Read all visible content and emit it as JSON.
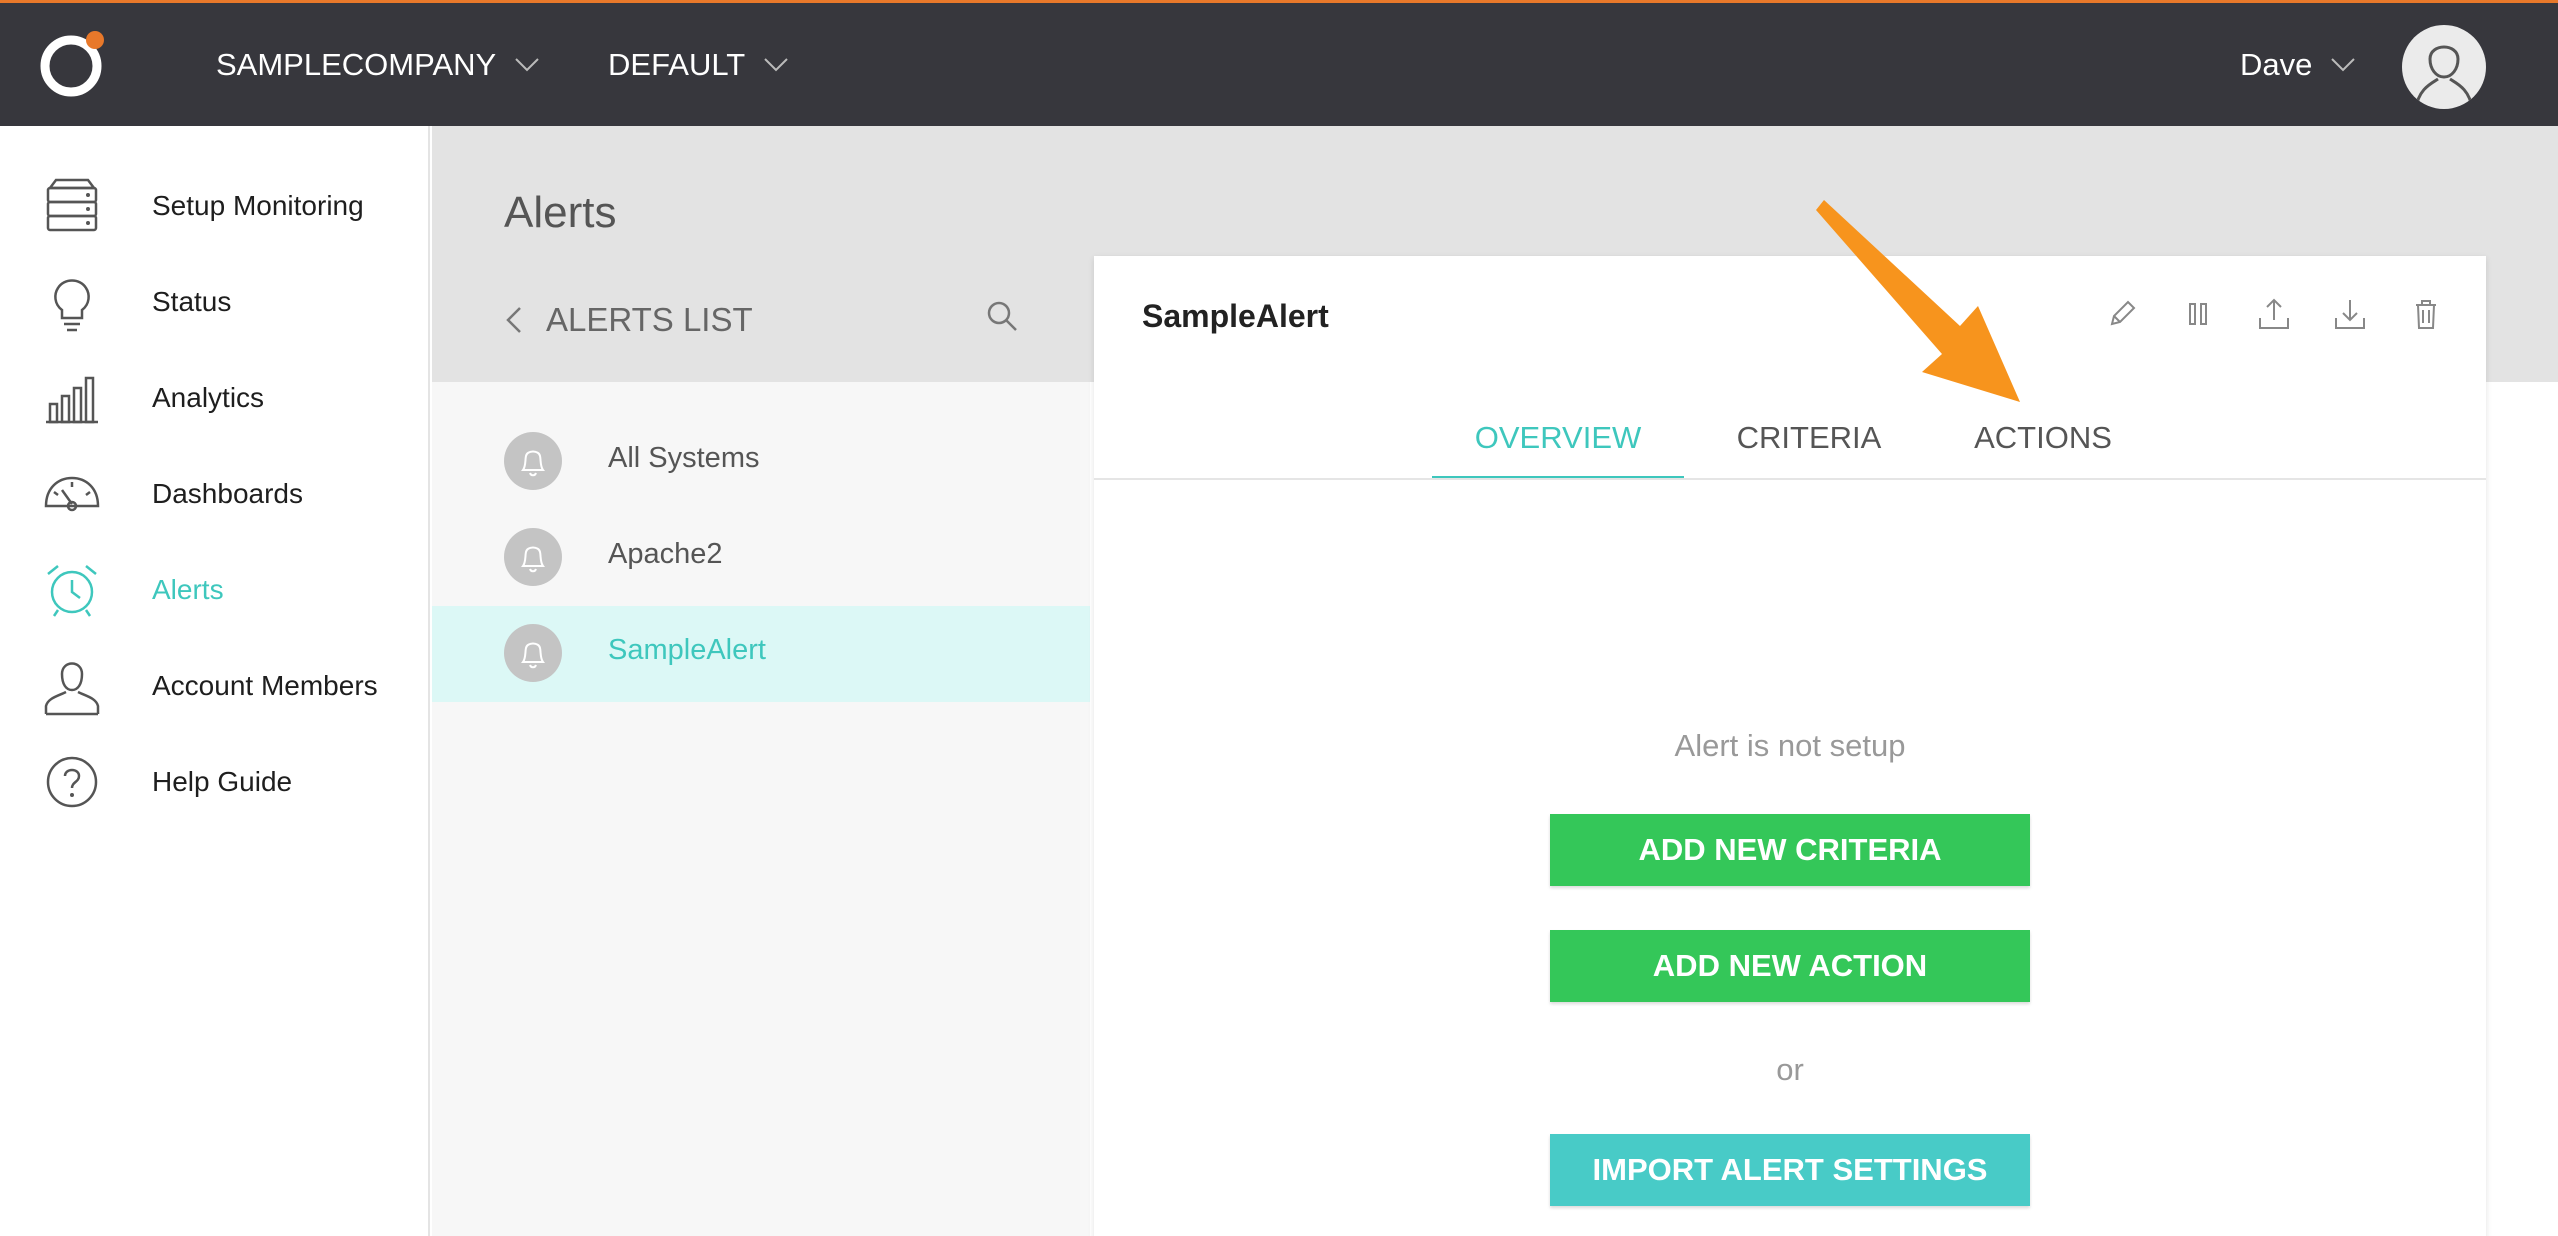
{
  "topbar": {
    "company": "SAMPLECOMPANY",
    "environment": "DEFAULT",
    "user": "Dave"
  },
  "sidebar": {
    "items": [
      {
        "label": "Setup Monitoring",
        "icon": "server-icon"
      },
      {
        "label": "Status",
        "icon": "lightbulb-icon"
      },
      {
        "label": "Analytics",
        "icon": "bar-chart-icon"
      },
      {
        "label": "Dashboards",
        "icon": "gauge-icon"
      },
      {
        "label": "Alerts",
        "icon": "alarm-clock-icon",
        "active": true
      },
      {
        "label": "Account Members",
        "icon": "user-icon"
      },
      {
        "label": "Help Guide",
        "icon": "question-icon"
      }
    ]
  },
  "main": {
    "title": "Alerts",
    "list_header": "ALERTS LIST",
    "alerts": [
      {
        "name": "All Systems"
      },
      {
        "name": "Apache2"
      },
      {
        "name": "SampleAlert",
        "selected": true
      }
    ]
  },
  "detail": {
    "title": "SampleAlert",
    "tabs": [
      "OVERVIEW",
      "CRITERIA",
      "ACTIONS"
    ],
    "active_tab": "OVERVIEW",
    "empty_message": "Alert is not setup",
    "add_criteria_label": "ADD NEW CRITERIA",
    "add_action_label": "ADD NEW ACTION",
    "or_label": "or",
    "import_label": "IMPORT ALERT SETTINGS"
  },
  "colors": {
    "topbar": "#37373d",
    "accent_orange": "#e8782a",
    "teal": "#3ec7bd",
    "green_button": "#34c759",
    "teal_button": "#48cbc7",
    "annotation_arrow": "#f7941d"
  }
}
